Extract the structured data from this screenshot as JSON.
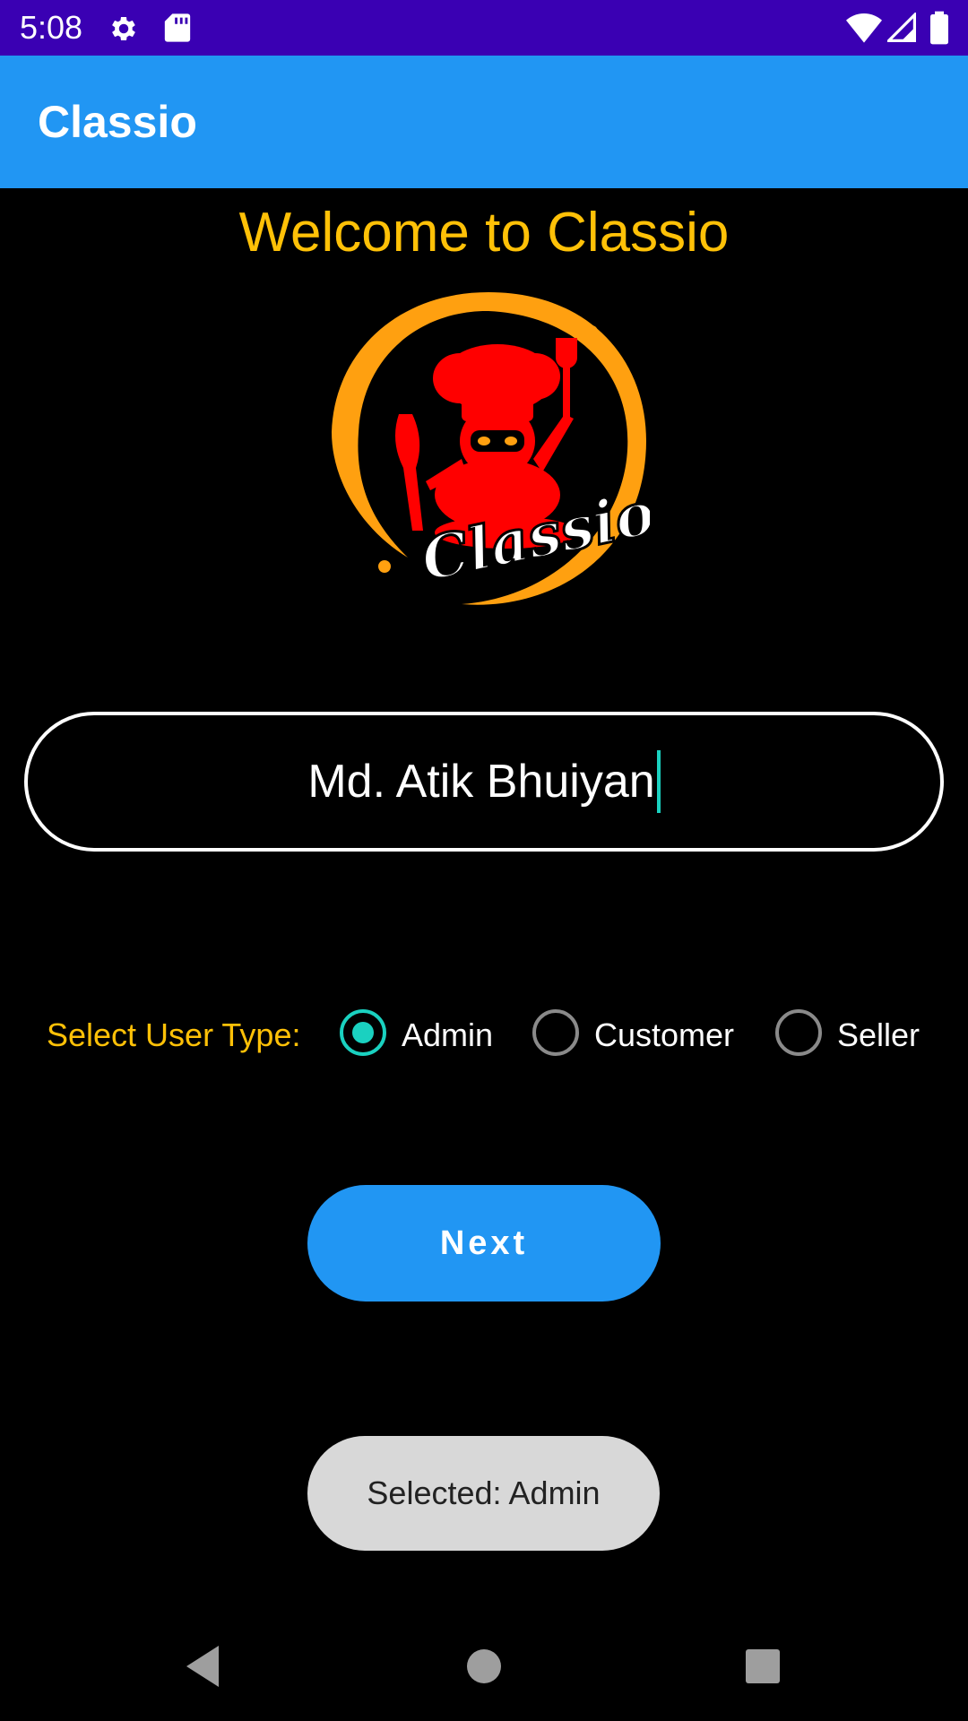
{
  "status_bar": {
    "time": "5:08",
    "icons": [
      "settings-icon",
      "sd-card-icon",
      "wifi-icon",
      "cellular-signal-icon",
      "battery-icon"
    ],
    "background": "#3a00b3"
  },
  "app_bar": {
    "title": "Classio",
    "background": "#2196f3"
  },
  "main": {
    "welcome_text": "Welcome to Classio",
    "logo": {
      "wordmark": "Classio",
      "accent_color": "#ffa010",
      "mascot_color": "#ff0000"
    },
    "name_field": {
      "value": "Md. Atik Bhuiyan"
    },
    "user_type": {
      "label": "Select User Type:",
      "options": [
        {
          "label": "Admin",
          "checked": true
        },
        {
          "label": "Customer",
          "checked": false
        },
        {
          "label": "Seller",
          "checked": false
        }
      ]
    },
    "next_button_label": "Next"
  },
  "toast": {
    "message": "Selected: Admin"
  },
  "nav_bar": {
    "icons": [
      "back-icon",
      "home-icon",
      "recents-icon"
    ]
  },
  "colors": {
    "accent_yellow": "#ffc107",
    "radio_checked": "#1ad1c0",
    "button_blue": "#2196f3"
  }
}
